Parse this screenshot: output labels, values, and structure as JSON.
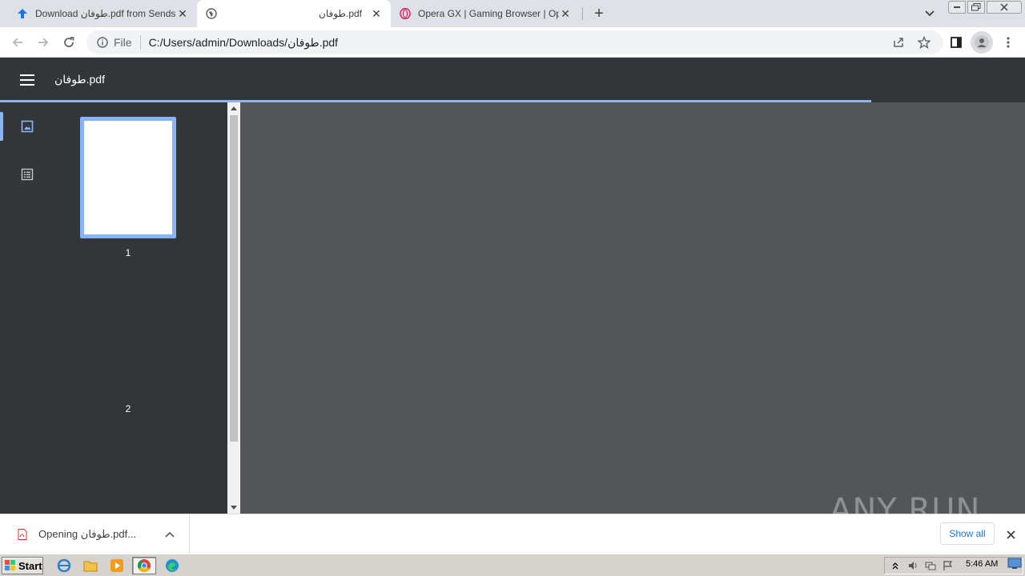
{
  "browser": {
    "tabs": [
      {
        "title": "Download طوفان.pdf from Sendspace.com",
        "favicon": "download-arrow-icon"
      },
      {
        "title": "طوفان.pdf",
        "favicon": "globe-icon"
      },
      {
        "title": "Opera GX | Gaming Browser | Opera",
        "favicon": "opera-icon"
      }
    ],
    "omnibox": {
      "scheme": "File",
      "url": "C:/Users/admin/Downloads/طوفان.pdf"
    }
  },
  "pdf": {
    "title": "طوفان.pdf",
    "thumbnails": [
      {
        "number": "1"
      },
      {
        "number": "2"
      }
    ],
    "load_progress": 0.85
  },
  "downloads": {
    "item_status": "Opening طوفان.pdf...",
    "show_all_label": "Show all"
  },
  "watermark": {
    "text": "ANY RUN"
  },
  "taskbar": {
    "start_label": "Start",
    "clock": "5:46 AM"
  },
  "colors": {
    "accent": "#8ab4f8",
    "pdf_toolbar": "#323639",
    "pdf_background": "#525659",
    "link": "#1a73e8"
  }
}
